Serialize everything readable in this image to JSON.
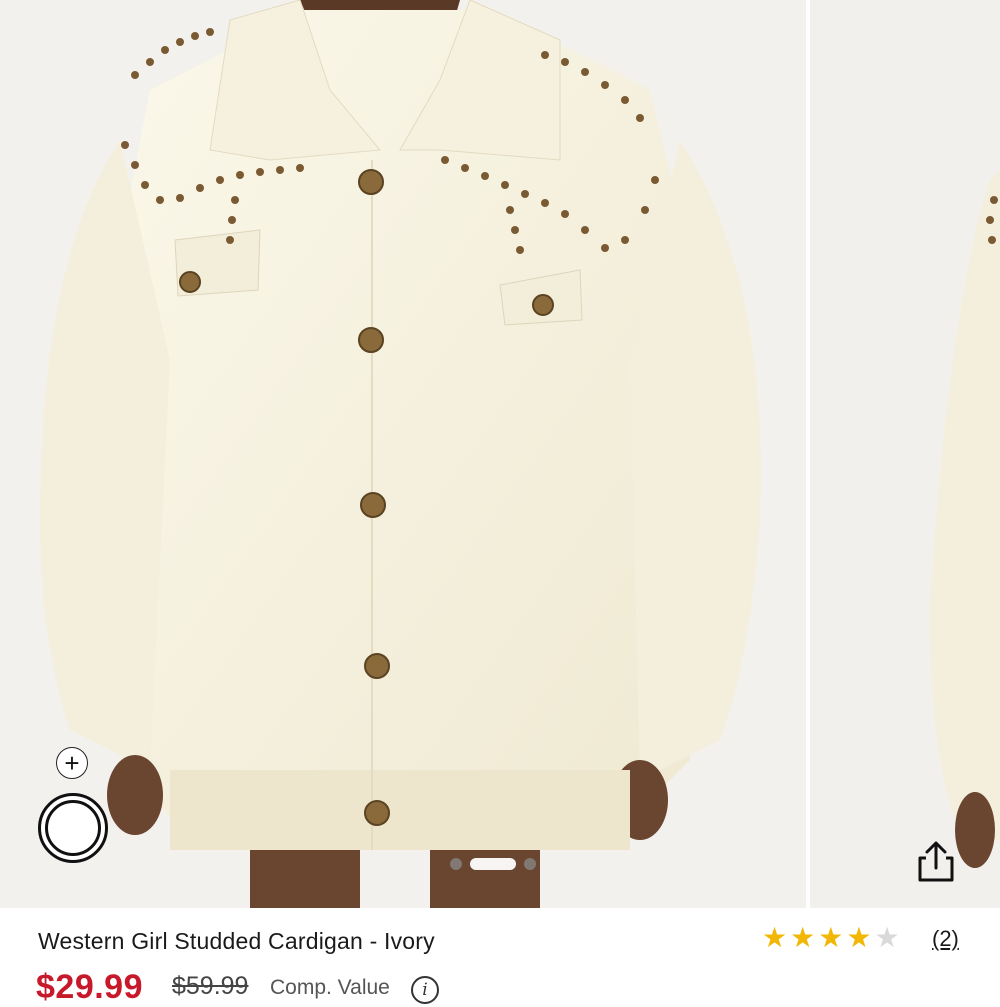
{
  "product": {
    "title": "Western Girl Studded Cardigan - Ivory",
    "rating": 4,
    "rating_max": 5,
    "review_count": "(2)",
    "price": "$29.99",
    "original_price": "$59.99",
    "comp_value_label": "Comp. Value",
    "info_icon_glyph": "i"
  },
  "gallery": {
    "image_count": 3,
    "active_index": 1,
    "add_icon_glyph": "+"
  },
  "colors": {
    "price_red": "#c8192b",
    "star_gold": "#f2b705",
    "star_empty": "#d9d9d9",
    "cardigan_ivory": "#f8f4e2",
    "stud_bronze": "#7a5a32"
  },
  "icons": {
    "share": "share-icon",
    "add": "plus-icon",
    "info": "info-icon",
    "star": "star-icon"
  }
}
